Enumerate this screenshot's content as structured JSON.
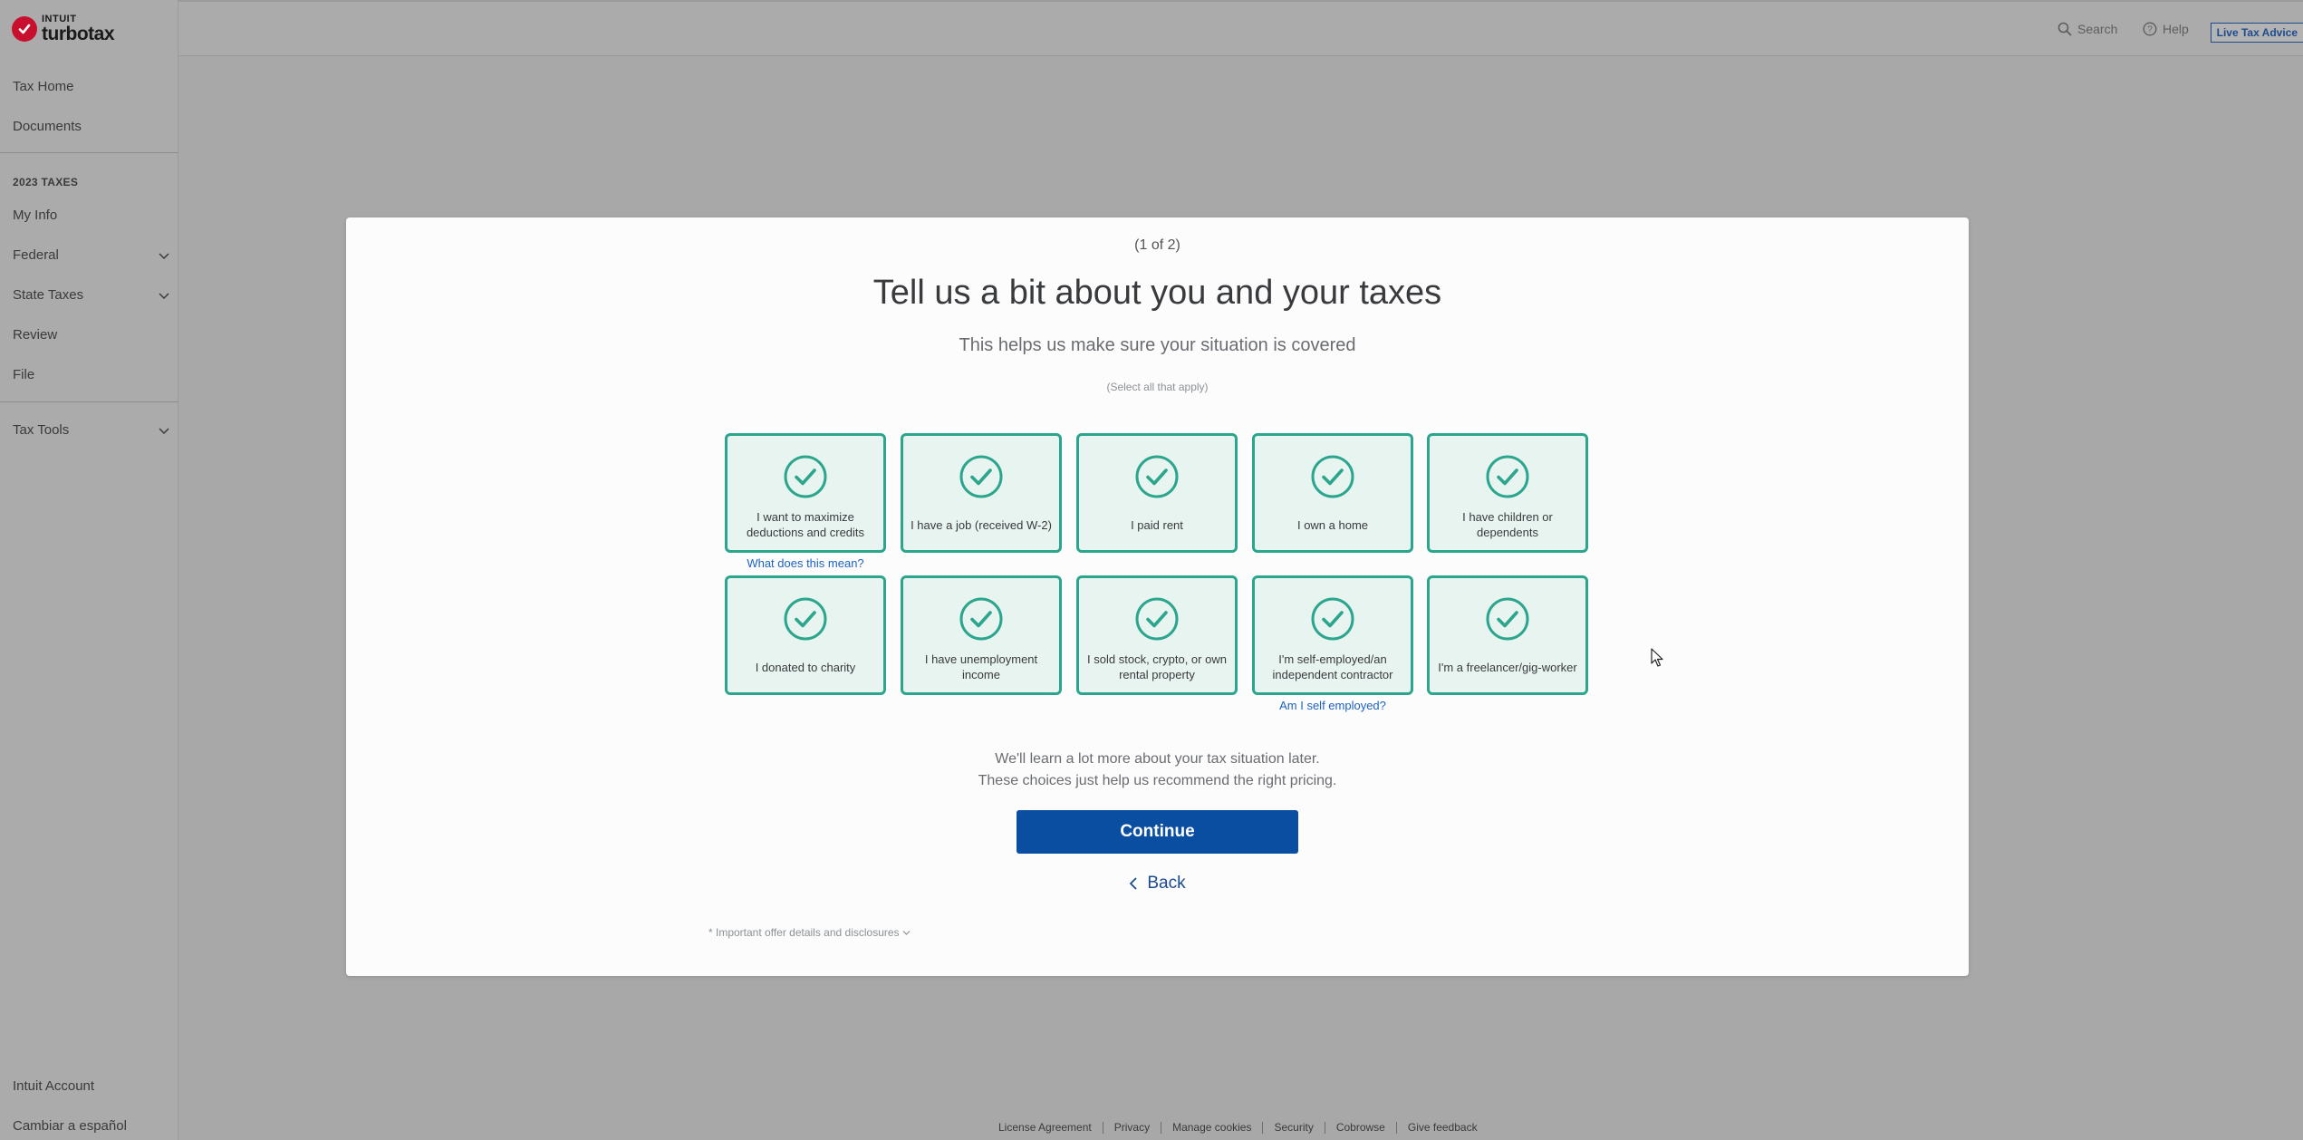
{
  "brand": {
    "company": "INTUIT",
    "product": "turbotax"
  },
  "sidebar": {
    "top_items": [
      {
        "label": "Tax Home"
      },
      {
        "label": "Documents"
      }
    ],
    "section_heading": "2023 TAXES",
    "tax_items": [
      {
        "label": "My Info",
        "expandable": false
      },
      {
        "label": "Federal",
        "expandable": true
      },
      {
        "label": "State Taxes",
        "expandable": true
      },
      {
        "label": "Review",
        "expandable": false
      },
      {
        "label": "File",
        "expandable": false
      }
    ],
    "tools_item": {
      "label": "Tax Tools",
      "expandable": true
    },
    "bottom_items": [
      {
        "label": "Intuit Account"
      },
      {
        "label": "Cambiar a español"
      }
    ]
  },
  "header": {
    "search_label": "Search",
    "help_label": "Help",
    "live_advice_label": "Live Tax Advice"
  },
  "modal": {
    "step": "(1 of 2)",
    "title": "Tell us a bit about you and your taxes",
    "subtitle": "This helps us make sure your situation is covered",
    "hint": "(Select all that apply)",
    "options_row1": [
      {
        "label": "I want to maximize deductions and credits",
        "selected": true
      },
      {
        "label": "I have a job (received W-2)",
        "selected": true
      },
      {
        "label": "I paid rent",
        "selected": true
      },
      {
        "label": "I own a home",
        "selected": true
      },
      {
        "label": "I have children or dependents",
        "selected": true
      }
    ],
    "options_row2": [
      {
        "label": "I donated to charity",
        "selected": true
      },
      {
        "label": "I have unemployment income",
        "selected": true
      },
      {
        "label": "I sold stock, crypto, or own rental property",
        "selected": true
      },
      {
        "label": "I'm self-employed/an independent contractor",
        "selected": true
      },
      {
        "label": "I'm a freelancer/gig-worker",
        "selected": true
      }
    ],
    "link_deductions": "What does this mean?",
    "link_self_employed": "Am I self employed?",
    "note_line1": "We'll learn a lot more about your tax situation later.",
    "note_line2": "These choices just help us recommend the right pricing.",
    "continue_label": "Continue",
    "back_label": "Back",
    "disclosure_label": "* Important offer details and disclosures"
  },
  "footer": {
    "links": [
      "License Agreement",
      "Privacy",
      "Manage cookies",
      "Security",
      "Cobrowse",
      "Give feedback"
    ]
  },
  "colors": {
    "accent_green": "#2ca58d",
    "card_fill": "#e7f4f0",
    "primary_blue": "#0a4ea2",
    "link_blue": "#1d62c4",
    "brand_red": "#c8102e"
  }
}
